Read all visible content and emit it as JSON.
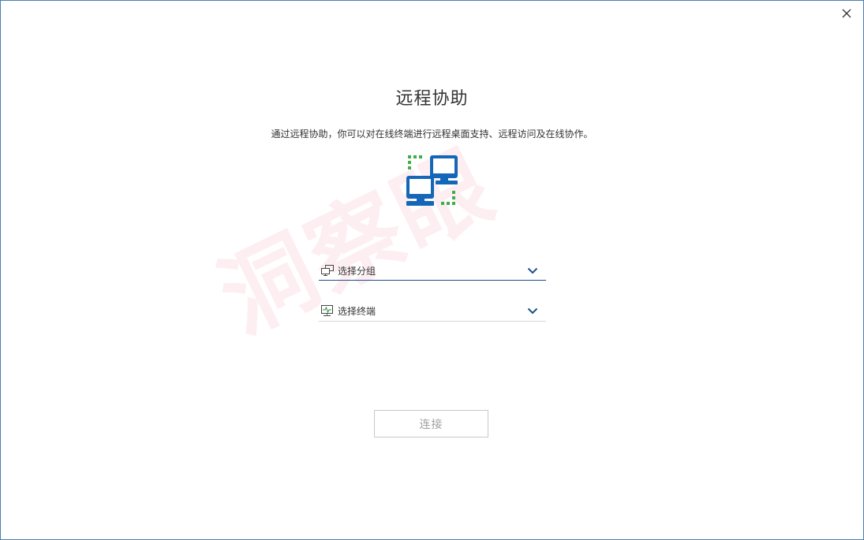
{
  "window": {
    "close_icon": "close-icon"
  },
  "header": {
    "title": "远程协助",
    "description": "通过远程协助，你可以对在线终端进行远程桌面支持、远程访问及在线协作。"
  },
  "hero": {
    "icon": "remote-computers-icon",
    "colors": {
      "monitor": "#1467b8",
      "dots": "#3fae49"
    }
  },
  "watermark": {
    "text": "洞察眼"
  },
  "form": {
    "group_select": {
      "icon": "group-computers-icon",
      "placeholder": "选择分组",
      "dropdown_icon": "chevron-down-icon"
    },
    "terminal_select": {
      "icon": "terminal-monitor-icon",
      "placeholder": "选择终端",
      "dropdown_icon": "chevron-down-icon"
    }
  },
  "actions": {
    "connect_label": "连接"
  },
  "colors": {
    "active_underline": "#1e4f88",
    "inactive_underline": "#d6d6d6",
    "disabled_text": "#a0a0a0"
  }
}
